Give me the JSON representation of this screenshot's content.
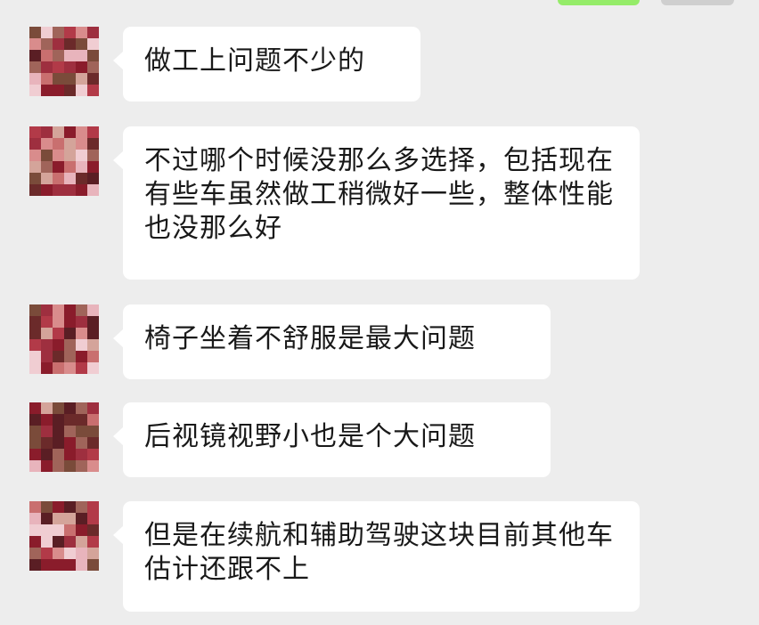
{
  "messages": [
    {
      "sender": "contact",
      "text": "做工上问题不少的"
    },
    {
      "sender": "contact",
      "text": "不过哪个时候没那么多选择，包括现在有些车虽然做工稍微好一些，整体性能也没那么好"
    },
    {
      "sender": "contact",
      "text": "椅子坐着不舒服是最大问题"
    },
    {
      "sender": "contact",
      "text": "后视镜视野小也是个大问题"
    },
    {
      "sender": "contact",
      "text": "但是在续航和辅助驾驶这块目前其他车估计还跟不上"
    }
  ],
  "colors": {
    "background": "#ededed",
    "received_bubble": "#ffffff",
    "sent_bubble": "#95ec69",
    "text": "#191919"
  }
}
